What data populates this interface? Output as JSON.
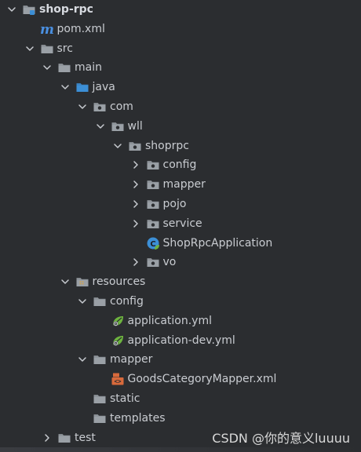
{
  "project": {
    "name": "shop-rpc",
    "pom": "pom.xml"
  },
  "tree": [
    {
      "id": "shop-rpc",
      "label": "shop-rpc",
      "depth": 0,
      "expanded": true,
      "kind": "module",
      "icon": "module-folder-icon",
      "bold": true
    },
    {
      "id": "pom",
      "label": "pom.xml",
      "depth": 1,
      "expanded": null,
      "kind": "file",
      "icon": "maven-icon"
    },
    {
      "id": "src",
      "label": "src",
      "depth": 1,
      "expanded": true,
      "kind": "folder",
      "icon": "folder-icon"
    },
    {
      "id": "main",
      "label": "main",
      "depth": 2,
      "expanded": true,
      "kind": "folder",
      "icon": "folder-icon"
    },
    {
      "id": "java",
      "label": "java",
      "depth": 3,
      "expanded": true,
      "kind": "source-root",
      "icon": "source-root-folder-icon"
    },
    {
      "id": "com",
      "label": "com",
      "depth": 4,
      "expanded": true,
      "kind": "package",
      "icon": "package-icon"
    },
    {
      "id": "wll",
      "label": "wll",
      "depth": 5,
      "expanded": true,
      "kind": "package",
      "icon": "package-icon"
    },
    {
      "id": "shoprpc",
      "label": "shoprpc",
      "depth": 6,
      "expanded": true,
      "kind": "package",
      "icon": "package-icon"
    },
    {
      "id": "config",
      "label": "config",
      "depth": 7,
      "expanded": false,
      "kind": "package",
      "icon": "package-icon"
    },
    {
      "id": "mapper",
      "label": "mapper",
      "depth": 7,
      "expanded": false,
      "kind": "package",
      "icon": "package-icon"
    },
    {
      "id": "pojo",
      "label": "pojo",
      "depth": 7,
      "expanded": false,
      "kind": "package",
      "icon": "package-icon"
    },
    {
      "id": "service",
      "label": "service",
      "depth": 7,
      "expanded": false,
      "kind": "package",
      "icon": "package-icon"
    },
    {
      "id": "ShopRpcApplication",
      "label": "ShopRpcApplication",
      "depth": 7,
      "expanded": null,
      "kind": "class",
      "icon": "spring-boot-class-icon"
    },
    {
      "id": "vo",
      "label": "vo",
      "depth": 7,
      "expanded": false,
      "kind": "package",
      "icon": "package-icon"
    },
    {
      "id": "resources",
      "label": "resources",
      "depth": 3,
      "expanded": true,
      "kind": "resources-root",
      "icon": "resources-folder-icon"
    },
    {
      "id": "res-config",
      "label": "config",
      "depth": 4,
      "expanded": true,
      "kind": "folder",
      "icon": "folder-icon"
    },
    {
      "id": "application-yml",
      "label": "application.yml",
      "depth": 5,
      "expanded": null,
      "kind": "file",
      "icon": "spring-yml-icon"
    },
    {
      "id": "application-dev-yml",
      "label": "application-dev.yml",
      "depth": 5,
      "expanded": null,
      "kind": "file",
      "icon": "spring-yml-icon"
    },
    {
      "id": "res-mapper",
      "label": "mapper",
      "depth": 4,
      "expanded": true,
      "kind": "folder",
      "icon": "folder-icon"
    },
    {
      "id": "goods-mapper-xml",
      "label": "GoodsCategoryMapper.xml",
      "depth": 5,
      "expanded": null,
      "kind": "file",
      "icon": "xml-file-icon"
    },
    {
      "id": "static",
      "label": "static",
      "depth": 4,
      "expanded": null,
      "kind": "folder",
      "icon": "folder-icon"
    },
    {
      "id": "templates",
      "label": "templates",
      "depth": 4,
      "expanded": null,
      "kind": "folder",
      "icon": "folder-icon"
    },
    {
      "id": "test",
      "label": "test",
      "depth": 2,
      "expanded": false,
      "kind": "folder",
      "icon": "folder-icon"
    }
  ],
  "watermark": "CSDN @你的意义luuuu",
  "colors": {
    "background": "#2b2d30",
    "text": "#c9ccd1",
    "folder": "#9aa0a6",
    "source_root": "#3c8fd6",
    "maven": "#4a90e2",
    "spring": "#6db33f",
    "xml": "#d86a3c"
  }
}
